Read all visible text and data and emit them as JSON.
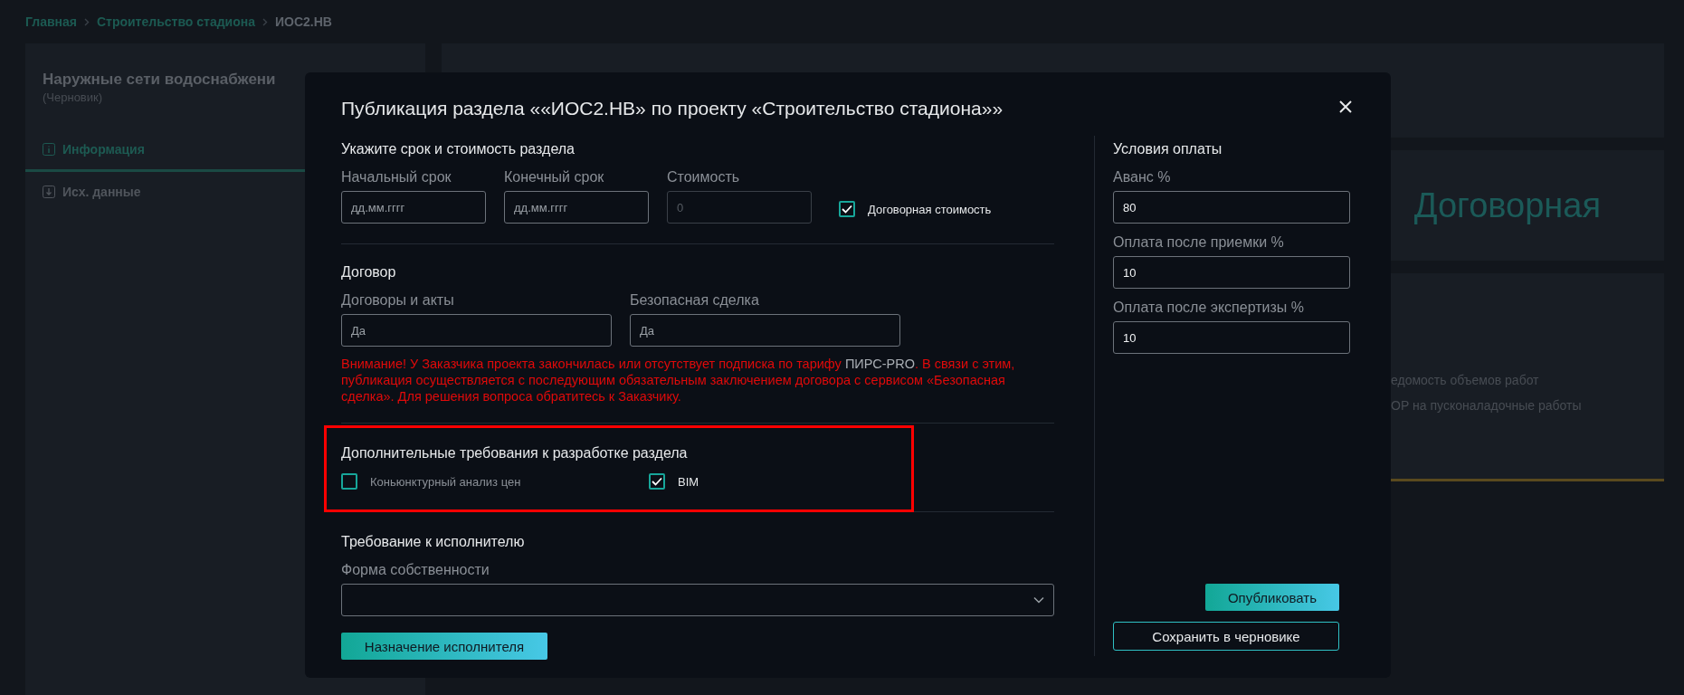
{
  "breadcrumbs": [
    {
      "label": "Главная",
      "current": false
    },
    {
      "label": "Строительство стадиона",
      "current": false
    },
    {
      "label": "ИОС2.НВ",
      "current": true
    }
  ],
  "sidebar": {
    "title": "Наружные сети водоснабжени",
    "status": "(Черновик)",
    "items": [
      {
        "label": "Информация",
        "selected": true,
        "kind": "info"
      },
      {
        "label": "Исх. данные",
        "selected": false,
        "kind": "download"
      }
    ]
  },
  "cost_card": {
    "value": "Договорная"
  },
  "documents_card": {
    "items": [
      "едомость объемов работ",
      "ОР на пусконаладочные работы"
    ]
  },
  "modal": {
    "title": "Публикация раздела ««ИОС2.НВ» по проекту «Строительство стадиона»»",
    "terms": {
      "heading": "Укажите срок и стоимость раздела",
      "fields": [
        {
          "label": "Начальный срок",
          "placeholder": "дд.мм.гггг",
          "disabled": false
        },
        {
          "label": "Конечный срок",
          "placeholder": "дд.мм.гггг",
          "disabled": false
        },
        {
          "label": "Стоимость",
          "placeholder": "0",
          "disabled": true
        }
      ],
      "negotiable": {
        "label": "Договорная стоимость",
        "checked": true
      }
    },
    "contract": {
      "heading": "Договор",
      "fields": [
        {
          "label": "Договоры и акты",
          "placeholder": "Да"
        },
        {
          "label": "Безопасная сделка",
          "placeholder": "Да"
        }
      ],
      "warning": {
        "before": "Внимание! У Заказчика проекта закончилась или отсутствует подписка по тарифу ",
        "highlight": "ПИРС-PRO",
        "after": ". В связи с этим, публикация осуществляется с последующим обязательным заключением договора с сервисом «Безопасная сделка». Для решения вопроса обратитесь к Заказчику."
      }
    },
    "extra": {
      "heading": "Дополнительные требования к разработке раздела",
      "highlighted": true,
      "options": [
        {
          "label": "Коньюнктурный анализ цен",
          "checked": false
        },
        {
          "label": "BIM",
          "checked": true
        }
      ]
    },
    "executor": {
      "heading": "Требование к исполнителю",
      "select_label": "Форма собственности",
      "button": "Назначение исполнителя"
    },
    "payment": {
      "heading": "Условия оплаты",
      "fields": [
        {
          "label": "Аванс %",
          "value": "80"
        },
        {
          "label": "Оплата после приемки %",
          "value": "10"
        },
        {
          "label": "Оплата после экспертизы %",
          "value": "10"
        }
      ]
    },
    "buttons": {
      "publish": "Опубликовать",
      "save": "Сохранить в черновике"
    }
  }
}
